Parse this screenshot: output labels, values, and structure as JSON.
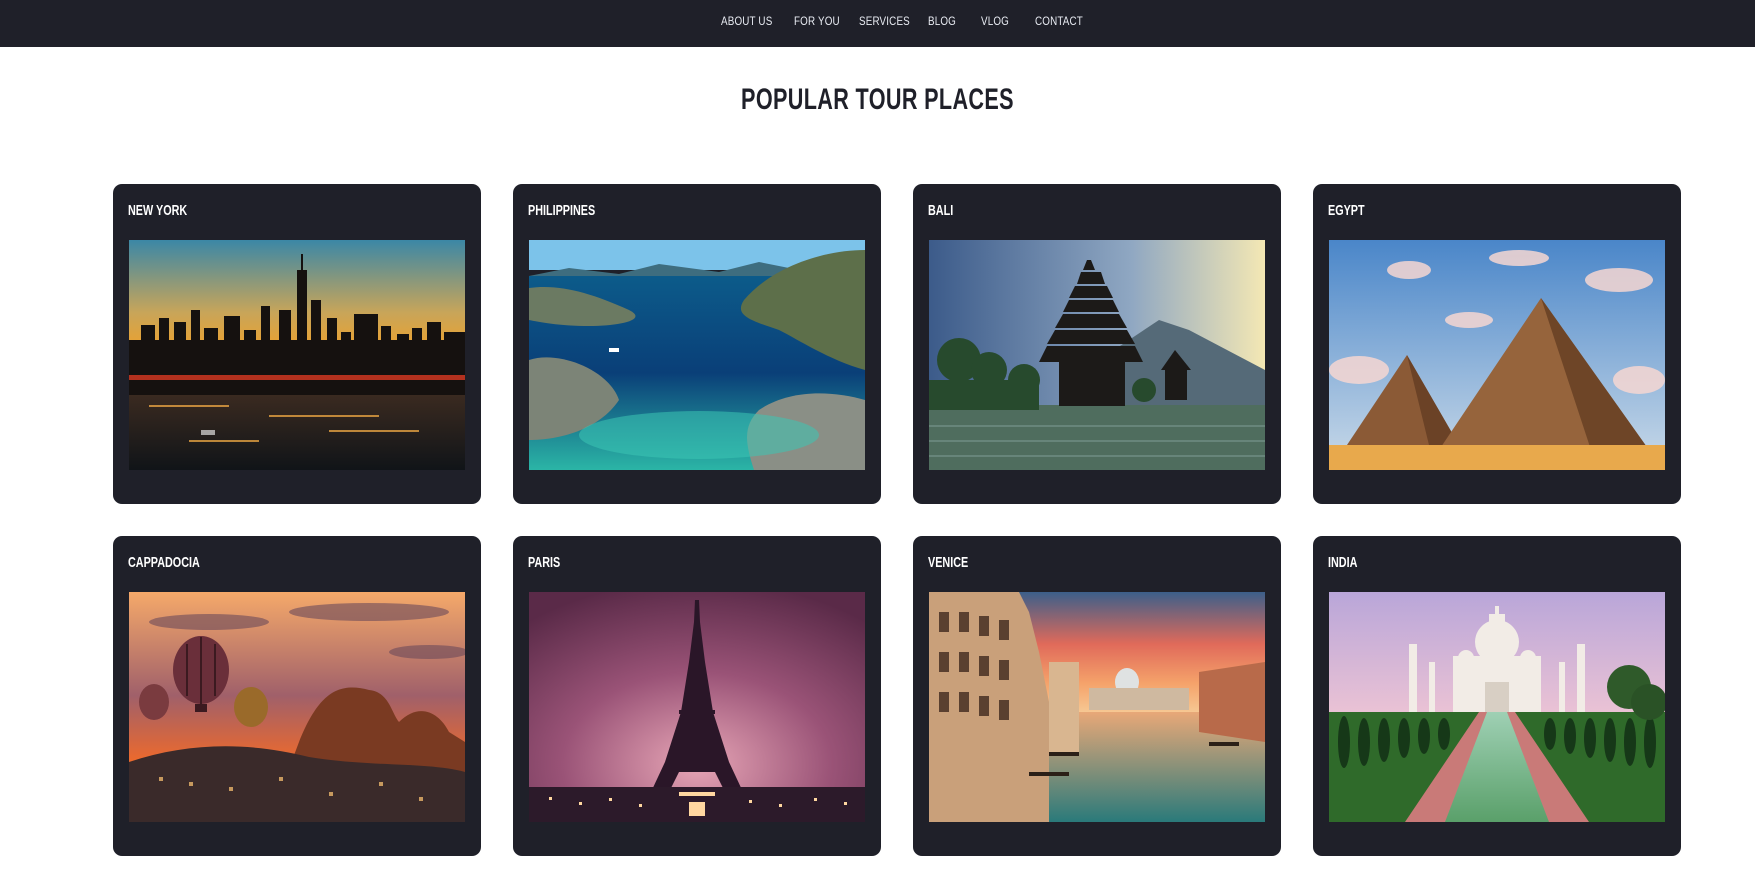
{
  "nav": {
    "items": [
      {
        "label": "ABOUT US"
      },
      {
        "label": "FOR YOU"
      },
      {
        "label": "SERVICES"
      },
      {
        "label": "BLOG"
      },
      {
        "label": "VLOG"
      },
      {
        "label": "CONTACT"
      }
    ]
  },
  "page": {
    "title": "POPULAR TOUR PLACES"
  },
  "colors": {
    "navbar_bg": "#1f2029",
    "card_bg": "#1f2029",
    "nav_text": "#e9ecf3",
    "title_text": "#1f2029"
  },
  "places": [
    {
      "title": "NEW YORK",
      "photo": "new-york-skyline-sunset"
    },
    {
      "title": "PHILIPPINES",
      "photo": "philippines-lagoon"
    },
    {
      "title": "BALI",
      "photo": "bali-temple"
    },
    {
      "title": "EGYPT",
      "photo": "egypt-pyramids"
    },
    {
      "title": "CAPPADOCIA",
      "photo": "cappadocia-balloons"
    },
    {
      "title": "PARIS",
      "photo": "paris-eiffel-tower"
    },
    {
      "title": "VENICE",
      "photo": "venice-grand-canal"
    },
    {
      "title": "INDIA",
      "photo": "india-taj-mahal"
    }
  ]
}
